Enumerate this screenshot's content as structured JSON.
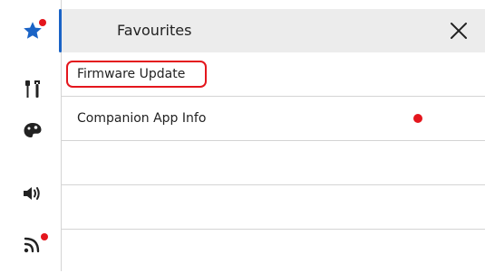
{
  "colors": {
    "accent": "#1a63c6",
    "notification": "#e4161d",
    "header_bg": "#ececec",
    "divider": "#d4d4d4"
  },
  "sidebar": {
    "items": [
      {
        "icon": "star-icon",
        "active": true,
        "notification": true
      },
      {
        "icon": "tools-icon",
        "active": false,
        "notification": false
      },
      {
        "icon": "palette-icon",
        "active": false,
        "notification": false
      },
      {
        "icon": "speaker-icon",
        "active": false,
        "notification": false
      },
      {
        "icon": "wifi-signal-icon",
        "active": false,
        "notification": true
      }
    ]
  },
  "panel": {
    "title": "Favourites",
    "close_icon": "close-icon",
    "items": [
      {
        "label": "Firmware Update",
        "highlighted": true,
        "notification": false
      },
      {
        "label": "Companion App Info",
        "highlighted": false,
        "notification": true
      }
    ]
  }
}
